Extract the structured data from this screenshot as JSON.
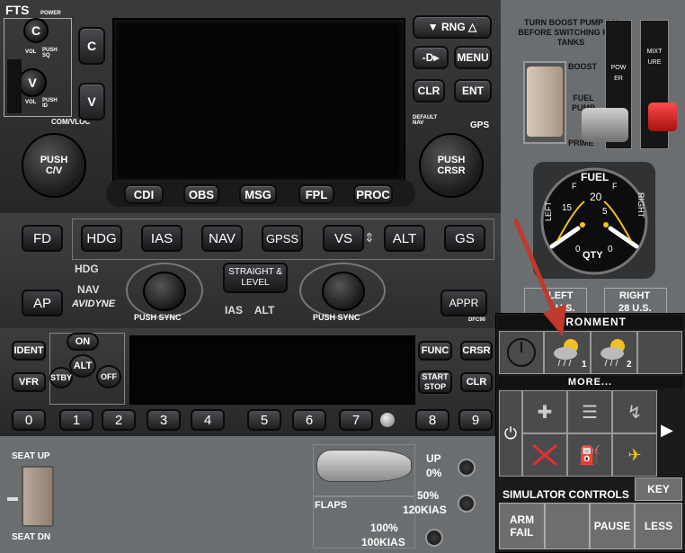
{
  "gps": {
    "fts": "FTS",
    "c_label": "C",
    "v_label": "V",
    "power": "POWER",
    "vol": "VOL",
    "push_sq": "PUSH SQ",
    "push_id": "PUSH ID",
    "com_vloc": "COM/VLOC",
    "push_cv": "PUSH C/V",
    "push_crsr": "PUSH CRSR",
    "rng": "RNG",
    "direct_to": "-D▸",
    "menu": "MENU",
    "clr": "CLR",
    "ent": "ENT",
    "default_nav": "DEFAULT NAV",
    "gps_label": "GPS",
    "bottom_buttons": [
      "CDI",
      "OBS",
      "MSG",
      "FPL",
      "PROC"
    ],
    "c_big": "C",
    "v_big": "V"
  },
  "autopilot": {
    "row1": [
      "FD",
      "HDG",
      "IAS",
      "NAV",
      "GPSS",
      "VS",
      "ALT",
      "GS"
    ],
    "ap": "AP",
    "appr": "APPR",
    "hdg_small": "HDG",
    "nav_small": "NAV",
    "brand": "AVIDYNE",
    "straight_level": "STRAIGHT & LEVEL",
    "push_sync_left": "PUSH SYNC",
    "push_sync_right": "PUSH SYNC",
    "ias_alt": "IAS    ALT",
    "model": "DFC90"
  },
  "transponder": {
    "ident": "IDENT",
    "vfr": "VFR",
    "on": "ON",
    "alt": "ALT",
    "stby": "STBY",
    "off": "OFF",
    "func": "FUNC",
    "crsr": "CRSR",
    "start_stop": "START STOP",
    "clr": "CLR",
    "digits": [
      "0",
      "1",
      "2",
      "3",
      "4",
      "5",
      "6",
      "7",
      "8",
      "9"
    ]
  },
  "seat": {
    "up": "SEAT UP",
    "down": "SEAT DN"
  },
  "flaps": {
    "label": "FLAPS",
    "up": "UP",
    "up_pct": "0%",
    "half": "50%",
    "half_speed": "120KIAS",
    "full": "100%",
    "full_speed": "100KIAS"
  },
  "engine": {
    "notice": "TURN BOOST PUMP ON BEFORE SWITCHING FUEL TANKS",
    "boost": "BOOST",
    "fuel_pump": "FUEL PUMP",
    "prime": "PRIME",
    "power": "POWER",
    "mixture": "MIXTURE"
  },
  "fuel_gauge": {
    "title": "FUEL",
    "left": "LEFT",
    "right": "RIGHT",
    "qty": "QTY",
    "scale": [
      "0",
      "5",
      "15",
      "20",
      "F",
      "F"
    ],
    "tank_left": "LEFT",
    "tank_left_cap": "U.S.",
    "tank_right": "RIGHT",
    "tank_right_cap": "28 U.S."
  },
  "environment": {
    "header": "VIRONMENT",
    "weather1": "1",
    "weather2": "2",
    "more": "MORE...",
    "sim_controls": "SIMULATOR CONTROLS",
    "key": "KEY",
    "arm_fail": "ARM FAIL",
    "pause": "PAUSE",
    "less": "LESS"
  },
  "colors": {
    "arrow": "#c0392b",
    "mixture_knob": "#d42020",
    "gauge_needle": "#f2c020"
  }
}
